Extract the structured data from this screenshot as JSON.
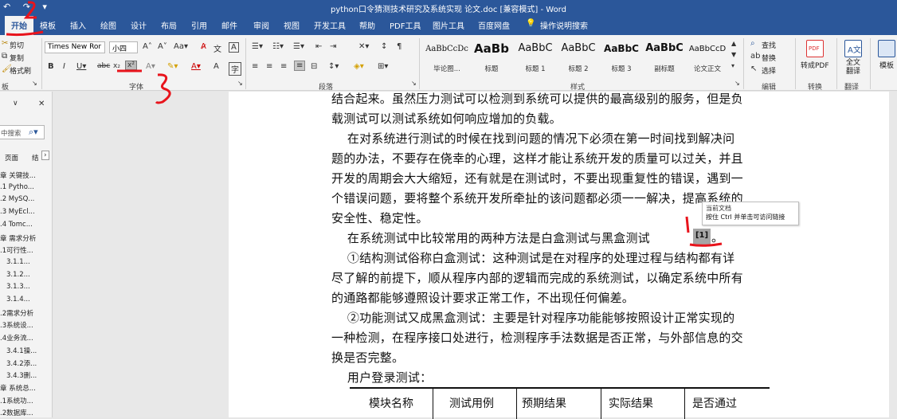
{
  "titlebar": {
    "title": "python口令猜测技术研究及系统实现   论文.doc [兼容模式] - Word",
    "qat": "↶ ↷ ▾"
  },
  "tabs": [
    "开始",
    "模板",
    "插入",
    "绘图",
    "设计",
    "布局",
    "引用",
    "邮件",
    "审阅",
    "视图",
    "开发工具",
    "帮助",
    "PDF工具",
    "图片工具",
    "百度网盘"
  ],
  "tell_me": "操作说明搜索",
  "ribbon": {
    "clipboard": {
      "cut": "剪切",
      "copy": "复制",
      "format_painter": "格式刷",
      "label": "板"
    },
    "font": {
      "name": "Times New Ror",
      "size": "小四",
      "label": "字体"
    },
    "paragraph": {
      "label": "段落"
    },
    "styles": {
      "label": "样式",
      "items": [
        {
          "sample": "AaBbCcDc",
          "name": "毕论图..."
        },
        {
          "sample": "AaBb",
          "name": "标题"
        },
        {
          "sample": "AaBbC",
          "name": "标题 1"
        },
        {
          "sample": "AaBbC",
          "name": "标题 2"
        },
        {
          "sample": "AaBbC",
          "name": "标题 3"
        },
        {
          "sample": "AaBbC",
          "name": "副标题"
        },
        {
          "sample": "AaBbCcD",
          "name": "论文正文"
        }
      ]
    },
    "editing": {
      "find": "查找",
      "replace": "替换",
      "select": "选择",
      "label": "编辑"
    },
    "convert": {
      "pdf": "转成PDF",
      "label": "转换"
    },
    "translate": {
      "full": "全文翻译",
      "label": "翻译"
    },
    "template": {
      "label": "模板"
    }
  },
  "nav": {
    "search_placeholder": "中搜索",
    "tabs": [
      "页面",
      "结"
    ],
    "items": [
      "章 关键技...",
      ".1 Pytho...",
      ".2 MySQ...",
      ".3 MyEcl...",
      ".4 Tomc...",
      "章 需求分析",
      ".1可行性...",
      "3.1.1...",
      "3.1.2...",
      "3.1.3...",
      "3.1.4...",
      ".2需求分析",
      ".3系统设...",
      ".4业务流...",
      "3.4.1操...",
      "3.4.2添...",
      "3.4.3删...",
      "章 系统总...",
      ".1系统功...",
      ".2数据库..."
    ]
  },
  "document": {
    "lines": [
      "结合起来。虽然压力测试可以检测到系统可以提供的最高级别的服务，但是负",
      "载测试可以测试系统如何响应增加的负载。",
      "    在对系统进行测试的时候在找到问题的情况下必须在第一时间找到解决问",
      "题的办法，不要存在侥幸的心理，这样才能让系统开发的质量可以过关，并且",
      "开发的周期会大大缩短，还有就是在测试时，不要出现重复性的错误，遇到一",
      "个错误问题，要将整个系统开发所牵扯的该问题都必须一一解决，提高系统的",
      "安全性、稳定性。",
      "    在系统测试中比较常用的两种方法是白盒测试与黑盒测试",
      "    ①结构测试俗称白盒测试：这种测试是在对程序的处理过程与结构都有详",
      "尽了解的前提下，顺从程序内部的逻辑而完成的系统测试，以确定系统中所有",
      "的通路都能够遵照设计要求正常工作，不出现任何偏差。",
      "    ②功能测试又成黑盒测试：主要是针对程序功能能够按照设计正常实现的",
      "一种检测，在程序接口处进行，检测程序手法数据是否正常，与外部信息的交",
      "换是否完整。",
      "    用户登录测试："
    ],
    "reference": "[1]",
    "reference_suffix": "。",
    "table_headers": [
      "模块名称",
      "测试用例",
      "预期结果",
      "实际结果",
      "是否通过"
    ]
  },
  "tooltip": {
    "line1": "当前文档",
    "line2": "按住 Ctrl 并单击可访问链接"
  }
}
